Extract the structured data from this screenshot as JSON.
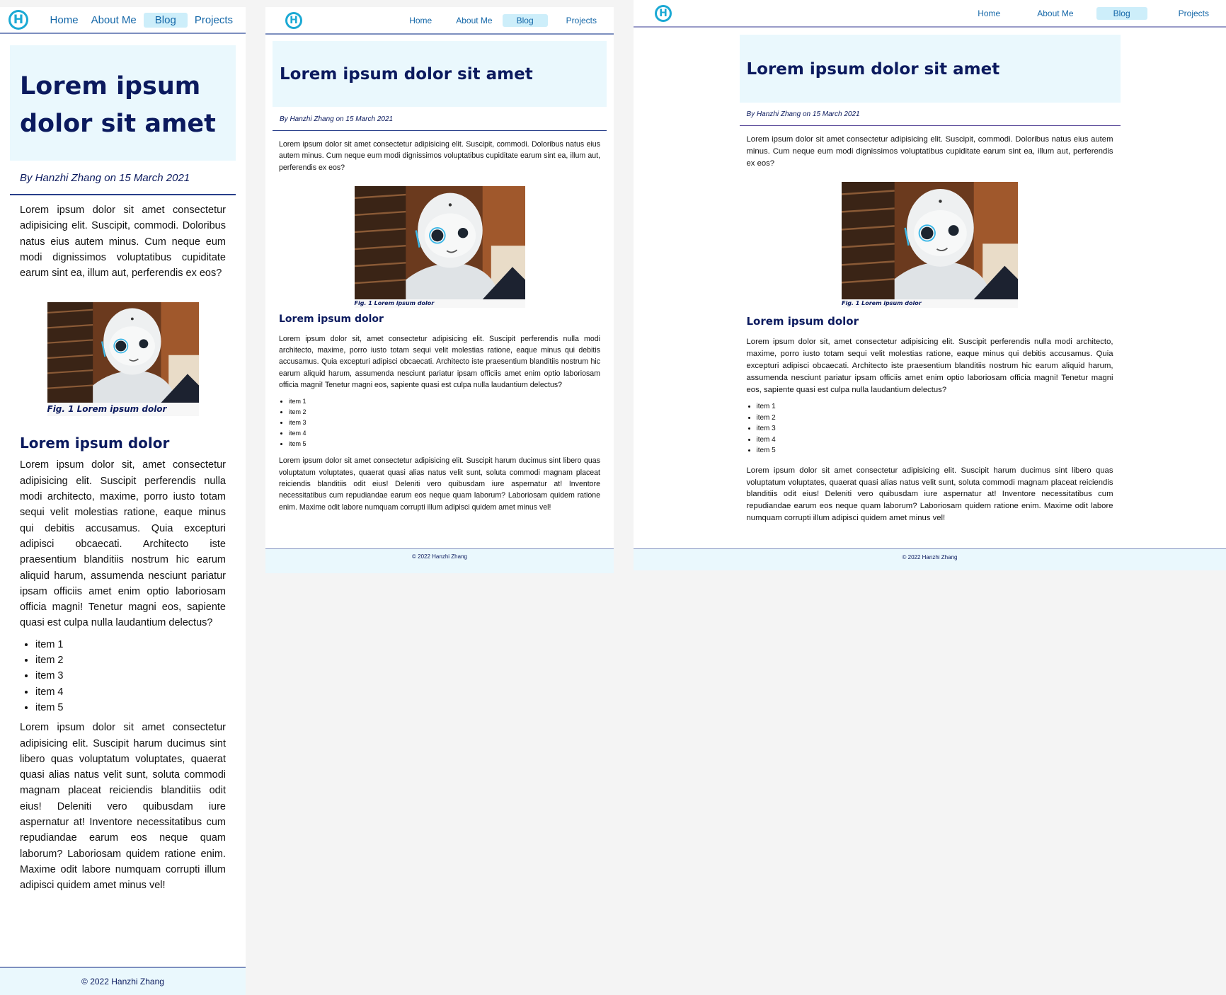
{
  "logo": {
    "letter": "H"
  },
  "nav": {
    "home": "Home",
    "about": "About Me",
    "blog": "Blog",
    "projects": "Projects"
  },
  "article": {
    "title": "Lorem ipsum dolor sit amet",
    "byline": "By Hanzhi Zhang on 15 March 2021",
    "intro": "Lorem ipsum dolor sit amet consectetur adipisicing elit. Suscipit, commodi. Doloribus natus eius autem minus. Cum neque eum modi dignissimos voluptatibus cupiditate earum sint ea, illum aut, perferendis ex eos?",
    "figure_caption": "Fig. 1 Lorem ipsum dolor",
    "subheading": "Lorem ipsum dolor",
    "body": "Lorem ipsum dolor sit, amet consectetur adipisicing elit. Suscipit perferendis nulla modi architecto, maxime, porro iusto totam sequi velit molestias ratione, eaque minus qui debitis accusamus. Quia excepturi adipisci obcaecati. Architecto iste praesentium blanditiis nostrum hic earum aliquid harum, assumenda nesciunt pariatur ipsam officiis amet enim optio laboriosam officia magni! Tenetur magni eos, sapiente quasi est culpa nulla laudantium delectus?",
    "list": [
      "item 1",
      "item 2",
      "item 3",
      "item 4",
      "item 5"
    ],
    "closing": "Lorem ipsum dolor sit amet consectetur adipisicing elit. Suscipit harum ducimus sint libero quas voluptatum voluptates, quaerat quasi alias natus velit sunt, soluta commodi magnam placeat reiciendis blanditiis odit eius! Deleniti vero quibusdam iure aspernatur at! Inventore necessitatibus cum repudiandae earum eos neque quam laborum? Laboriosam quidem ratione enim. Maxime odit labore numquam corrupti illum adipisci quidem amet minus vel!"
  },
  "footer": {
    "text": "© 2022 Hanzhi Zhang"
  },
  "colors": {
    "accent": "#1ba9d4",
    "heading": "#0b1a5e",
    "hero_bg": "#eaf8fd",
    "nav_active_bg": "#cdeefa"
  },
  "icons": {
    "logo": "h-logo-icon",
    "figure": "robot-photo"
  }
}
